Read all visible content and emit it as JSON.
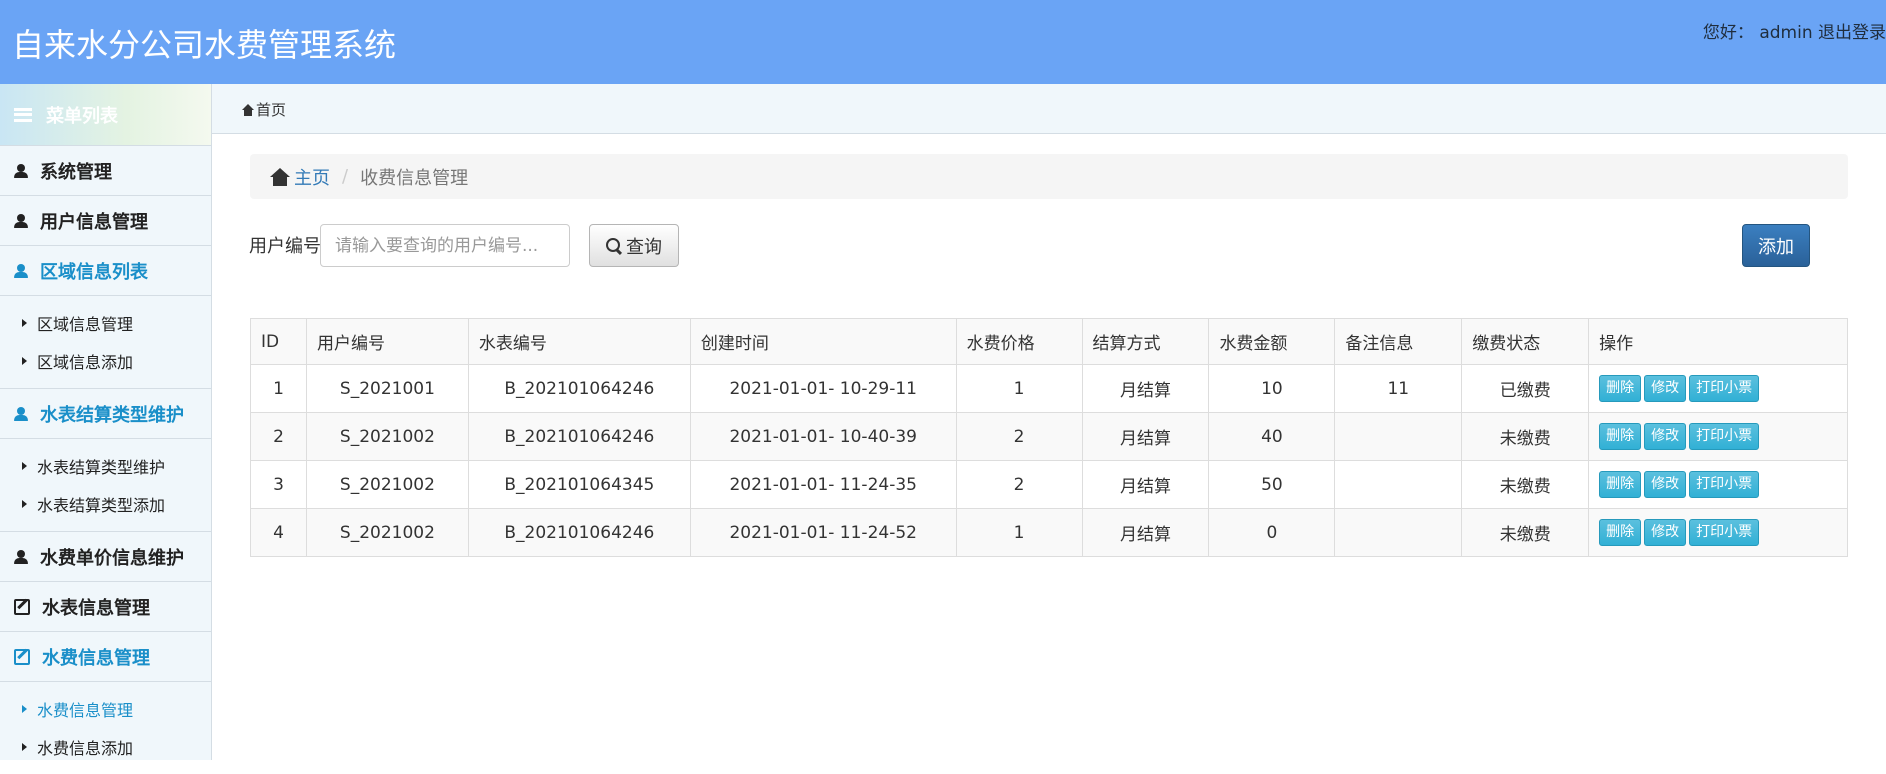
{
  "header": {
    "title": "自来水分公司水费管理系统",
    "greeting": "您好：  admin",
    "logout": "退出登录"
  },
  "sidebar": {
    "heading": "菜单列表",
    "menu": [
      {
        "label": "系统管理",
        "icon": "user-icon"
      },
      {
        "label": "用户信息管理",
        "icon": "user-icon"
      },
      {
        "label": "区域信息列表",
        "icon": "user-icon",
        "active": true,
        "sub": [
          "区域信息管理",
          "区域信息添加"
        ]
      },
      {
        "label": "水表结算类型维护",
        "icon": "user-icon",
        "active": true,
        "sub": [
          "水表结算类型维护",
          "水表结算类型添加"
        ]
      },
      {
        "label": "水费单价信息维护",
        "icon": "user-icon"
      },
      {
        "label": "水表信息管理",
        "icon": "edit-icon"
      },
      {
        "label": "水费信息管理",
        "icon": "edit-icon",
        "active": true,
        "sub": [
          "水费信息管理",
          "水费信息添加"
        ]
      }
    ]
  },
  "tabs": {
    "home": "首页"
  },
  "breadcrumb": {
    "home": "主页",
    "separator": "/",
    "current": "收费信息管理"
  },
  "search": {
    "label": "用户编号",
    "placeholder": "请输入要查询的用户编号...",
    "button": "查询"
  },
  "add_button": "添加",
  "table": {
    "columns": [
      "ID",
      "用户编号",
      "水表编号",
      "创建时间",
      "水费价格",
      "结算方式",
      "水费金额",
      "备注信息",
      "缴费状态",
      "操作"
    ],
    "rows": [
      {
        "id": "1",
        "user": "S_2021001",
        "meter": "B_202101064246",
        "created": "2021-01-01- 10-29-11",
        "price": "1",
        "settle": "月结算",
        "amount": "10",
        "note": "11",
        "status": "已缴费"
      },
      {
        "id": "2",
        "user": "S_2021002",
        "meter": "B_202101064246",
        "created": "2021-01-01- 10-40-39",
        "price": "2",
        "settle": "月结算",
        "amount": "40",
        "note": "",
        "status": "未缴费"
      },
      {
        "id": "3",
        "user": "S_2021002",
        "meter": "B_202101064345",
        "created": "2021-01-01- 11-24-35",
        "price": "2",
        "settle": "月结算",
        "amount": "50",
        "note": "",
        "status": "未缴费"
      },
      {
        "id": "4",
        "user": "S_2021002",
        "meter": "B_202101064246",
        "created": "2021-01-01- 11-24-52",
        "price": "1",
        "settle": "月结算",
        "amount": "0",
        "note": "",
        "status": "未缴费"
      }
    ],
    "actions": {
      "delete": "删除",
      "edit": "修改",
      "print": "打印小票"
    }
  },
  "colors": {
    "header_bg": "#6aa4f5",
    "active_menu": "#1a8fc9",
    "primary_button": "#2a6199",
    "info_button": "#31b0d5"
  }
}
